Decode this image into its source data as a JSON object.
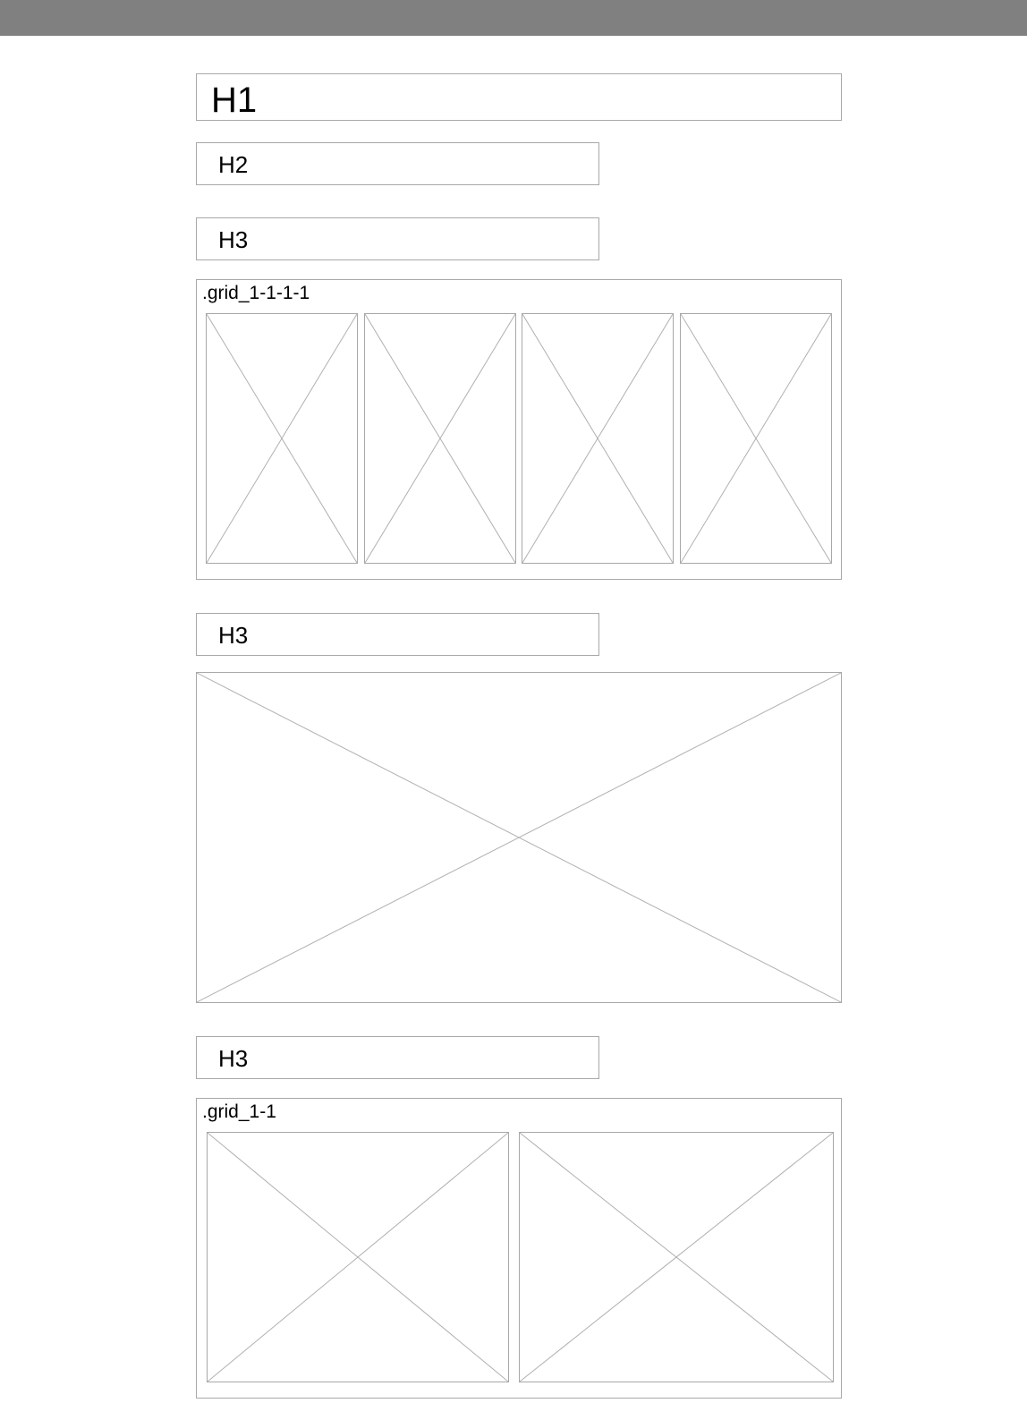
{
  "headings": {
    "h1": "H1",
    "h2": "H2",
    "h3_first": "H3",
    "h3_second": "H3",
    "h3_third": "H3"
  },
  "grids": {
    "four_col_label": ".grid_1-1-1-1",
    "two_col_label": ".grid_1-1"
  },
  "placeholder_icon": "image-placeholder-x"
}
